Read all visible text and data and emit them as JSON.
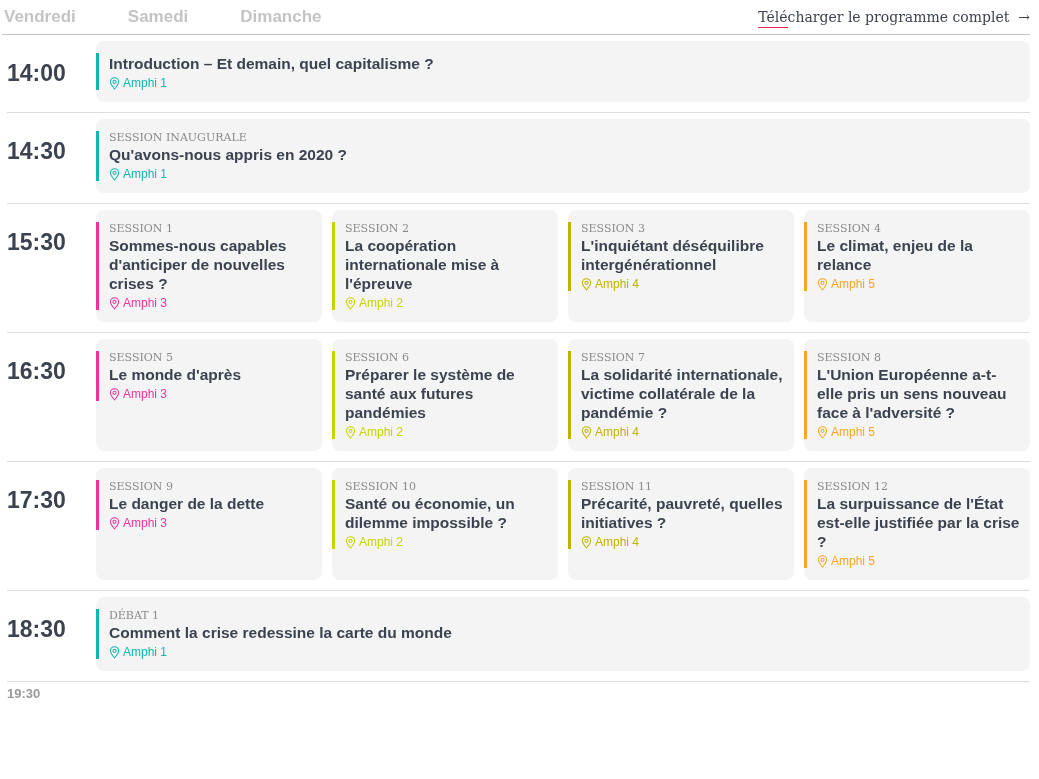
{
  "days": [
    {
      "label": "Vendredi",
      "selected": false
    },
    {
      "label": "Samedi",
      "selected": false
    },
    {
      "label": "Dimanche",
      "selected": false
    }
  ],
  "download_link": {
    "label": "Télécharger le programme complet",
    "arrow": "→"
  },
  "slots": [
    {
      "time": "14:00",
      "sessions": [
        {
          "title": "Introduction – Et demain, quel capitalisme ?",
          "room": "Amphi 1",
          "color": "#13b5b1"
        }
      ]
    },
    {
      "time": "14:30",
      "sessions": [
        {
          "label": "SESSION INAUGURALE",
          "title": "Qu'avons-nous appris en 2020 ?",
          "room": "Amphi 1",
          "color": "#13b5b1"
        }
      ]
    },
    {
      "time": "15:30",
      "sessions": [
        {
          "label": "SESSION 1",
          "title": "Sommes-nous capables d'anticiper de nouvelles crises ?",
          "room": "Amphi 3",
          "color": "#f0339a"
        },
        {
          "label": "SESSION 2",
          "title": "La coopération internationale mise à l'épreuve",
          "room": "Amphi 2",
          "color": "#c8d400"
        },
        {
          "label": "SESSION 3",
          "title": "L'inquiétant déséquilibre intergénérationnel",
          "room": "Amphi 4",
          "color": "#c2b100"
        },
        {
          "label": "SESSION 4",
          "title": "Le climat, enjeu de la relance",
          "room": "Amphi 5",
          "color": "#f5a623"
        }
      ]
    },
    {
      "time": "16:30",
      "sessions": [
        {
          "label": "SESSION 5",
          "title": "Le monde d'après",
          "room": "Amphi 3",
          "color": "#f0339a"
        },
        {
          "label": "SESSION 6",
          "title": "Préparer le système de santé aux futures pandémies",
          "room": "Amphi 2",
          "color": "#c8d400"
        },
        {
          "label": "SESSION 7",
          "title": "La solidarité internationale, victime collatérale de la pandémie ?",
          "room": "Amphi 4",
          "color": "#c2b100"
        },
        {
          "label": "SESSION 8",
          "title": "L'Union Européenne a-t-elle pris un sens nouveau face à l'adversité ?",
          "room": "Amphi 5",
          "color": "#f5a623"
        }
      ]
    },
    {
      "time": "17:30",
      "sessions": [
        {
          "label": "SESSION 9",
          "title": "Le danger de la dette",
          "room": "Amphi 3",
          "color": "#f0339a"
        },
        {
          "label": "SESSION 10",
          "title": "Santé ou économie, un dilemme impossible ?",
          "room": "Amphi 2",
          "color": "#c8d400"
        },
        {
          "label": "SESSION 11",
          "title": "Précarité, pauvreté, quelles initiatives ?",
          "room": "Amphi 4",
          "color": "#c2b100"
        },
        {
          "label": "SESSION 12",
          "title": "La surpuissance de l'État est-elle justifiée par la crise ?",
          "room": "Amphi 5",
          "color": "#f5a623"
        }
      ]
    },
    {
      "time": "18:30",
      "sessions": [
        {
          "label": "DÉBAT 1",
          "title": "Comment la crise redessine la carte du monde",
          "room": "Amphi 1",
          "color": "#13b5b1"
        }
      ]
    }
  ],
  "end_time": "19:30"
}
